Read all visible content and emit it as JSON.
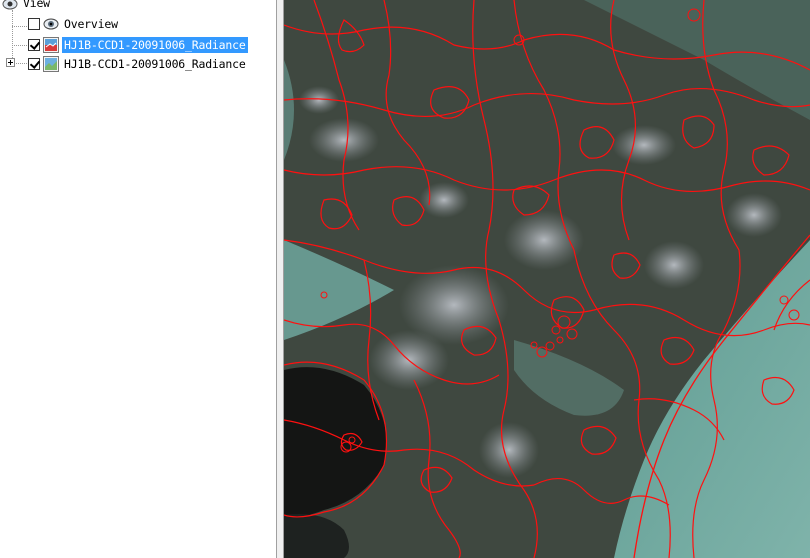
{
  "tree": {
    "root_label": "View",
    "items": [
      {
        "label": "Overview",
        "checked": false,
        "selected": false,
        "icon": "overview-eye-icon"
      },
      {
        "label": "HJ1B-CCD1-20091006_Radiance",
        "checked": true,
        "selected": true,
        "icon": "raster-layer-icon"
      },
      {
        "label": "HJ1B-CCD1-20091006_Radiance",
        "checked": true,
        "selected": false,
        "icon": "raster-layer-icon",
        "expandable": true
      }
    ]
  },
  "map": {
    "content": "satellite-image-with-red-boundaries",
    "boundary_color": "#ff1010",
    "sea_color": "#6fa79e",
    "land_color": "#3f4840",
    "water_dark_color": "#141514"
  }
}
